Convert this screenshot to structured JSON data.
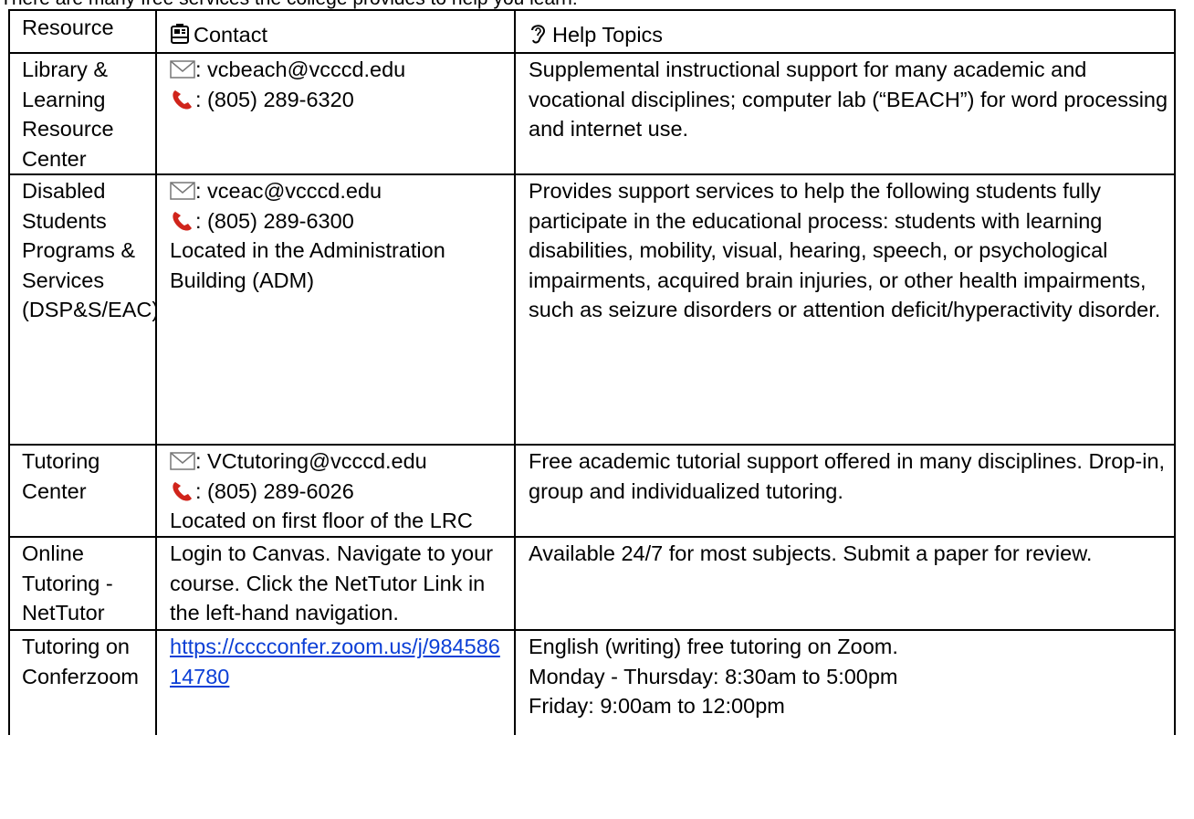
{
  "intro_text": "There are many free services the college provides to help you learn:",
  "headers": {
    "resource": "Resource",
    "contact": "Contact",
    "help": "Help Topics"
  },
  "rows": [
    {
      "resource": "Library & Learning Resource Center",
      "email": ": vcbeach@vcccd.edu",
      "phone": ": (805) 289-6320",
      "location": "",
      "help": "Supplemental instructional support for many academic and vocational disciplines; computer lab (“BEACH”) for word processing and internet use."
    },
    {
      "resource": "Disabled Students Programs & Services (DSP&S/EAC)",
      "email": ": vceac@vcccd.edu",
      "phone": ": (805) 289-6300",
      "location": "Located in the Administration Building (ADM)",
      "help": "Provides support services to help the following students fully participate in the educational process: students with learning disabilities, mobility, visual, hearing, speech, or psychological impairments, acquired brain injuries, or other health impairments, such as seizure disorders or attention deficit/hyperactivity disorder."
    },
    {
      "resource": "Tutoring Center",
      "email": ": VCtutoring@vcccd.edu",
      "phone": ": (805) 289-6026",
      "location": "Located on first floor of the LRC",
      "help": "Free academic tutorial support offered in many disciplines. Drop-in, group and individualized tutoring."
    },
    {
      "resource": "Online Tutoring - NetTutor",
      "contact_text": "Login to Canvas. Navigate to your course. Click the NetTutor Link in the left-hand navigation.",
      "help": "Available 24/7 for most subjects. Submit a paper for review."
    },
    {
      "resource": "Tutoring on Conferzoom",
      "link": "https://cccconfer.zoom.us/j/98458614780",
      "help_lines": [
        "English (writing) free tutoring on Zoom.",
        "Monday - Thursday: 8:30am to 5:00pm",
        "Friday: 9:00am to 12:00pm"
      ]
    }
  ],
  "icons": {
    "contact": "contact-card-icon",
    "help": "ear-icon",
    "email": "envelope-icon",
    "phone": "phone-icon"
  }
}
